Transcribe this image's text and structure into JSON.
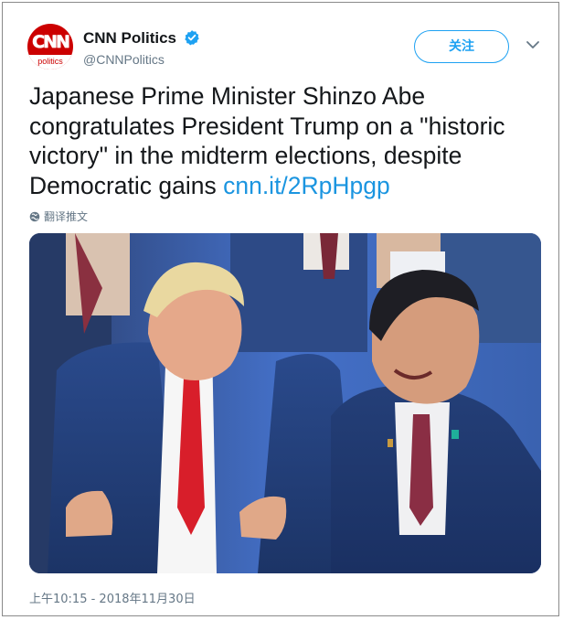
{
  "account": {
    "avatar_brand": "CNN",
    "avatar_sub": "politics",
    "display_name": "CNN Politics",
    "handle": "@CNNPolitics",
    "verified": true
  },
  "actions": {
    "follow_label": "关注",
    "menu_icon": "chevron-down-icon"
  },
  "tweet": {
    "text": "Japanese Prime Minister Shinzo Abe congratulates President Trump on a \"historic victory\" in the midterm elections, despite Democratic gains",
    "link": "cnn.it/2RpHpgp",
    "translate_label": "翻译推文",
    "timestamp": "上午10:15 - 2018年11月30日"
  },
  "colors": {
    "brand_red": "#cc0000",
    "link_blue": "#1b95e0",
    "follow_blue": "#1da1f2",
    "muted": "#657786"
  }
}
